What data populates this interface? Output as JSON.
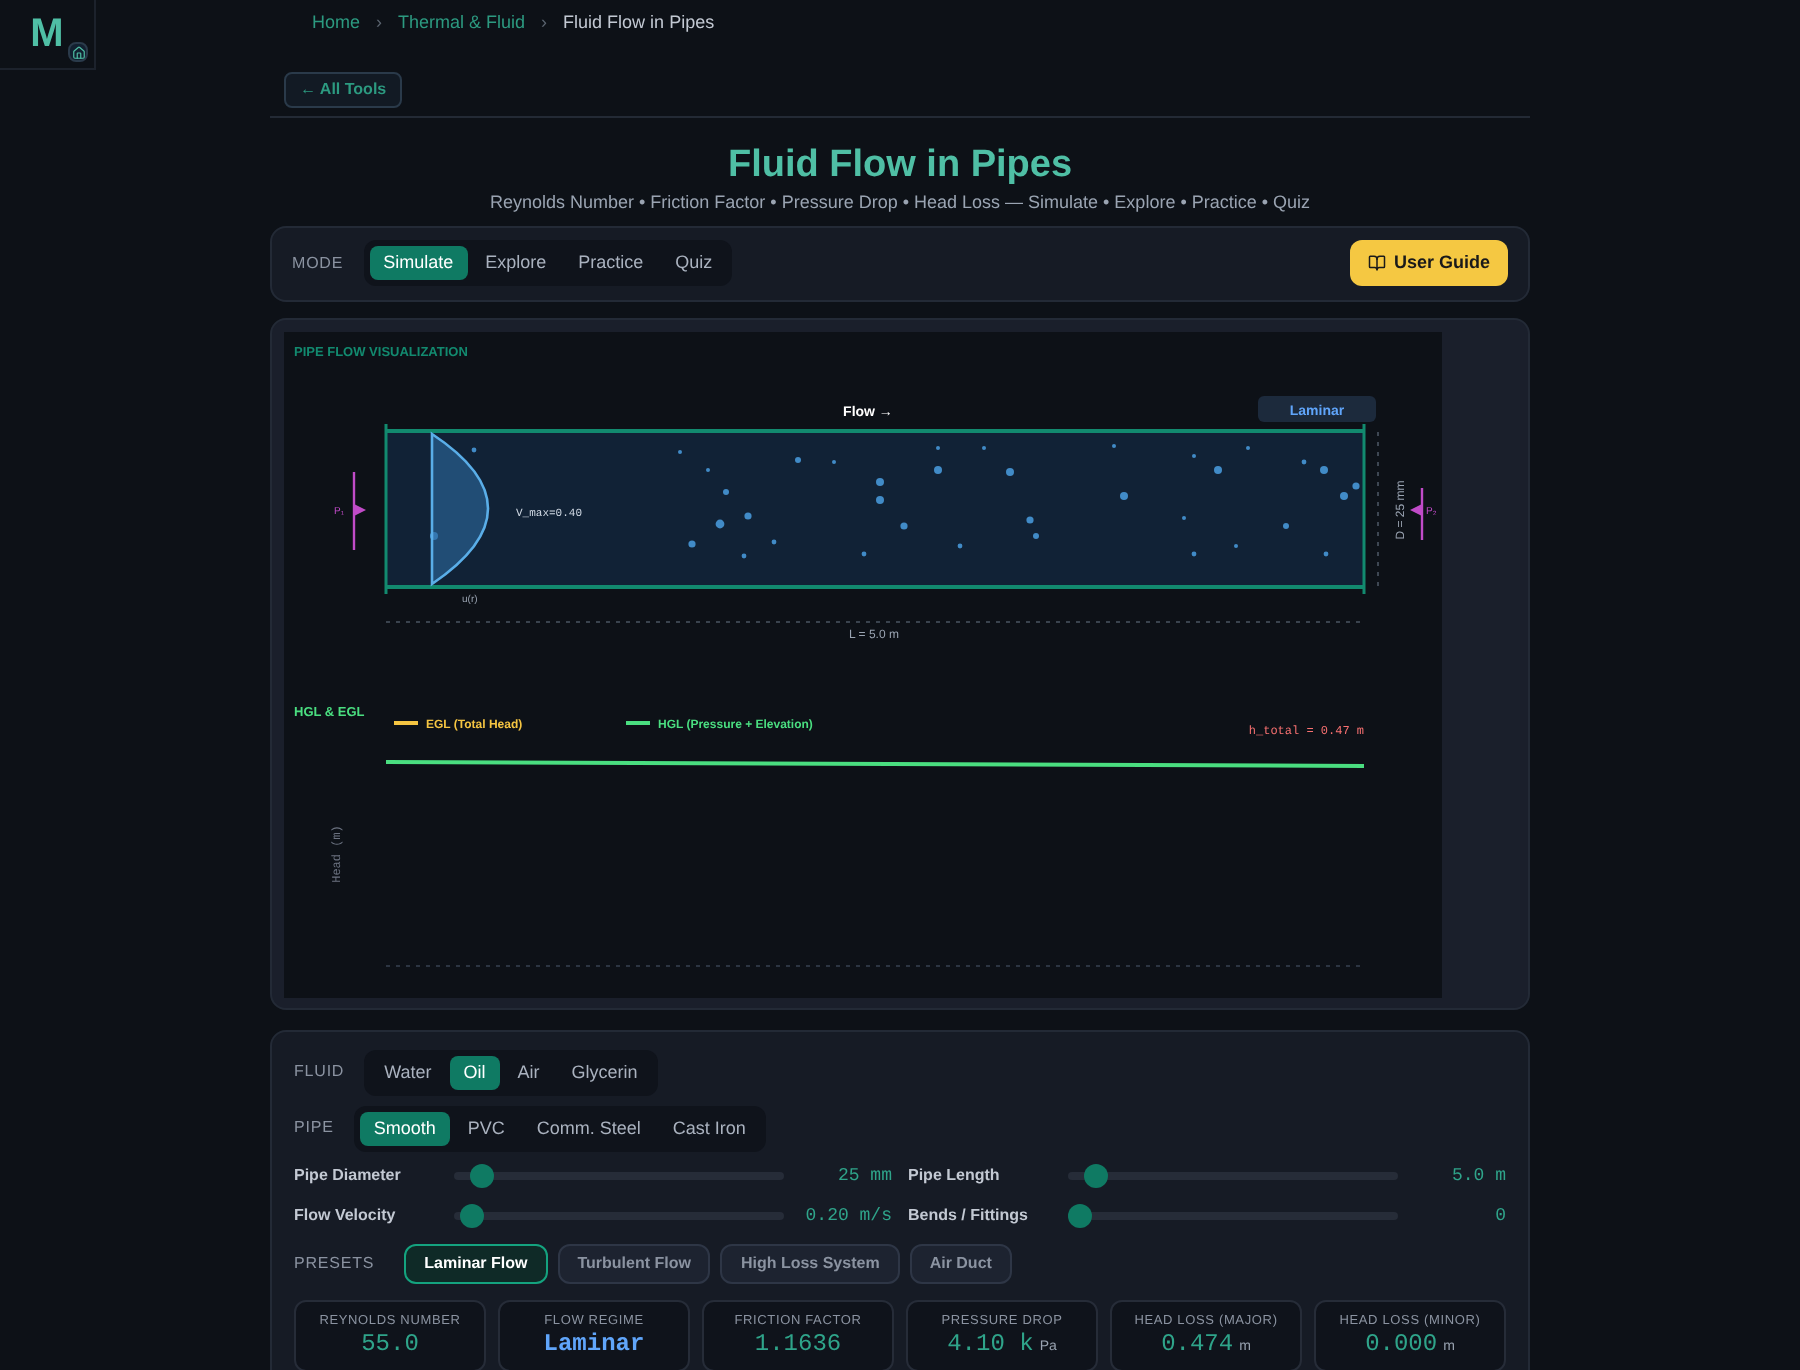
{
  "logo": {
    "letter": "M"
  },
  "breadcrumb": [
    {
      "label": "Home",
      "current": false
    },
    {
      "label": "Thermal & Fluid",
      "current": false
    },
    {
      "label": "Fluid Flow in Pipes",
      "current": true
    }
  ],
  "breadcrumb_separator": "›",
  "back_button": "← All Tools",
  "title": "Fluid Flow in Pipes",
  "subtitle": "Reynolds Number • Friction Factor • Pressure Drop • Head Loss — Simulate • Explore • Practice • Quiz",
  "mode": {
    "label": "MODE",
    "options": [
      {
        "label": "Simulate",
        "selected": true
      },
      {
        "label": "Explore",
        "selected": false
      },
      {
        "label": "Practice",
        "selected": false
      },
      {
        "label": "Quiz",
        "selected": false
      }
    ]
  },
  "user_guide": "User Guide",
  "visualization": {
    "title": "PIPE FLOW VISUALIZATION",
    "flow_label": "Flow →",
    "regime_badge": "Laminar",
    "vmax_label": "V_max=0.40",
    "profile_label": "u(r)",
    "length_label": "L = 5.0 m",
    "diameter_label": "D = 25 mm",
    "inlet_label": "P₁",
    "outlet_label": "P₂"
  },
  "head_chart": {
    "title": "HGL & EGL",
    "legend": [
      {
        "label": "EGL (Total Head)",
        "color": "#f5c542"
      },
      {
        "label": "HGL (Pressure + Elevation)",
        "color": "#4ade80"
      }
    ],
    "total_label": "h_total = 0.47 m",
    "ylabel": "Head (m)"
  },
  "controls": {
    "fluid": {
      "label": "FLUID",
      "options": [
        {
          "label": "Water",
          "selected": false
        },
        {
          "label": "Oil",
          "selected": true
        },
        {
          "label": "Air",
          "selected": false
        },
        {
          "label": "Glycerin",
          "selected": false
        }
      ]
    },
    "pipe": {
      "label": "PIPE",
      "options": [
        {
          "label": "Smooth",
          "selected": true
        },
        {
          "label": "PVC",
          "selected": false
        },
        {
          "label": "Comm. Steel",
          "selected": false
        },
        {
          "label": "Cast Iron",
          "selected": false
        }
      ]
    },
    "sliders": [
      {
        "label": "Pipe Diameter",
        "value": "25 mm",
        "level": 0.05
      },
      {
        "label": "Pipe Length",
        "value": "5.0 m",
        "level": 0.05
      },
      {
        "label": "Flow Velocity",
        "value": "0.20 m/s",
        "level": 0.02
      },
      {
        "label": "Bends / Fittings",
        "value": "0",
        "level": 0.0
      }
    ],
    "presets": {
      "label": "PRESETS",
      "options": [
        {
          "label": "Laminar Flow",
          "selected": true
        },
        {
          "label": "Turbulent Flow",
          "selected": false
        },
        {
          "label": "High Loss System",
          "selected": false
        },
        {
          "label": "Air Duct",
          "selected": false
        }
      ]
    }
  },
  "metrics": [
    {
      "kind": "number",
      "label": "REYNOLDS NUMBER",
      "value": "55.0"
    },
    {
      "kind": "regime",
      "label": "FLOW REGIME",
      "value": "Laminar"
    },
    {
      "kind": "number",
      "label": "FRICTION FACTOR",
      "value": "1.1636"
    },
    {
      "kind": "number",
      "label": "PRESSURE DROP",
      "value": "4.10 k",
      "unit": "Pa"
    },
    {
      "kind": "number",
      "label": "HEAD LOSS (MAJOR)",
      "value": "0.474",
      "unit": "m"
    },
    {
      "kind": "number",
      "label": "HEAD LOSS (MINOR)",
      "value": "0.000",
      "unit": "m"
    }
  ]
}
